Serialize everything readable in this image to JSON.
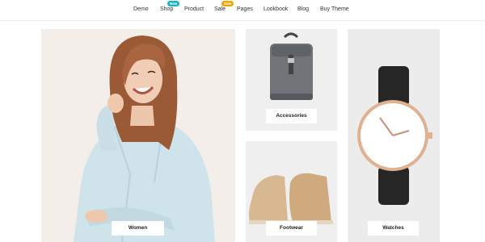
{
  "nav": {
    "items": [
      {
        "label": "Demo"
      },
      {
        "label": "Shop",
        "badge": "New"
      },
      {
        "label": "Product"
      },
      {
        "label": "Sale",
        "badge": "Sale"
      },
      {
        "label": "Pages"
      },
      {
        "label": "Lookbook"
      },
      {
        "label": "Blog"
      },
      {
        "label": "Buy Theme"
      }
    ]
  },
  "categories": {
    "women": "Women",
    "accessories": "Accessories",
    "footwear": "Footwear",
    "watches": "Watches"
  },
  "colors": {
    "badge_new": "#17b3c9",
    "badge_sale": "#f0a500",
    "tile_bg": "#efefef"
  }
}
